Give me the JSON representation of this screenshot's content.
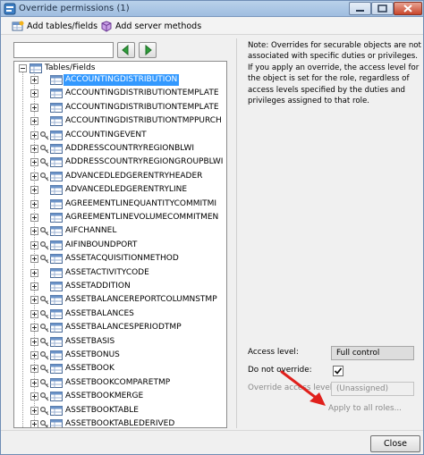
{
  "window": {
    "title": "Override permissions (1)"
  },
  "toolbar": {
    "add_tables_label": "Add tables/fields",
    "add_methods_label": "Add server methods"
  },
  "search": {
    "value": ""
  },
  "tree": {
    "root_label": "Tables/Fields",
    "items": [
      "ACCOUNTINGDISTRIBUTION",
      "ACCOUNTINGDISTRIBUTIONTEMPLATE",
      "ACCOUNTINGDISTRIBUTIONTEMPLATE",
      "ACCOUNTINGDISTRIBUTIONTMPPURCH",
      "ACCOUNTINGEVENT",
      "ADDRESSCOUNTRYREGIONBLWI",
      "ADDRESSCOUNTRYREGIONGROUPBLWI",
      "ADVANCEDLEDGERENTRYHEADER",
      "ADVANCEDLEDGERENTRYLINE",
      "AGREEMENTLINEQUANTITYCOMMITMI",
      "AGREEMENTLINEVOLUMECOMMITMEN",
      "AIFCHANNEL",
      "AIFINBOUNDPORT",
      "ASSETACQUISITIONMETHOD",
      "ASSETACTIVITYCODE",
      "ASSETADDITION",
      "ASSETBALANCEREPORTCOLUMNSTMP",
      "ASSETBALANCES",
      "ASSETBALANCESPERIODTMP",
      "ASSETBASIS",
      "ASSETBONUS",
      "ASSETBOOK",
      "ASSETBOOKCOMPARETMP",
      "ASSETBOOKMERGE",
      "ASSETBOOKTABLE",
      "ASSETBOOKTABLEDERIVED"
    ]
  },
  "note": {
    "text": "Note: Overrides for securable objects are not associated with specific duties or privileges. If you apply an override, the access level for the object is set for the role, regardless of access levels specified by the duties and privileges assigned to that role."
  },
  "props": {
    "access_level_label": "Access level:",
    "access_level_value": "Full control",
    "do_not_override_label": "Do not override:",
    "do_not_override_checked": true,
    "override_access_label": "Override access level:",
    "override_access_value": "(Unassigned)",
    "apply_all_label": "Apply to all roles..."
  },
  "footer": {
    "close_label": "Close"
  },
  "colors": {
    "selection": "#3399ff",
    "arrow": "#e0201c"
  }
}
